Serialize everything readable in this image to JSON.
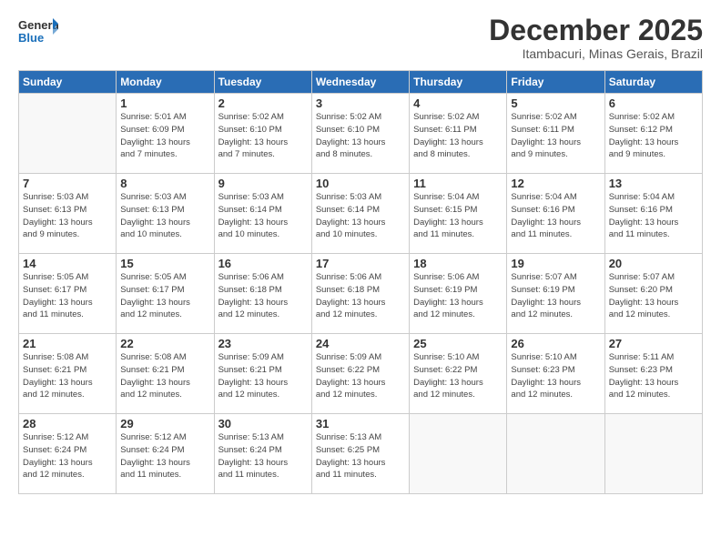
{
  "header": {
    "logo_line1": "General",
    "logo_line2": "Blue",
    "month": "December 2025",
    "location": "Itambacuri, Minas Gerais, Brazil"
  },
  "weekdays": [
    "Sunday",
    "Monday",
    "Tuesday",
    "Wednesday",
    "Thursday",
    "Friday",
    "Saturday"
  ],
  "weeks": [
    [
      {
        "day": "",
        "info": ""
      },
      {
        "day": "1",
        "info": "Sunrise: 5:01 AM\nSunset: 6:09 PM\nDaylight: 13 hours\nand 7 minutes."
      },
      {
        "day": "2",
        "info": "Sunrise: 5:02 AM\nSunset: 6:10 PM\nDaylight: 13 hours\nand 7 minutes."
      },
      {
        "day": "3",
        "info": "Sunrise: 5:02 AM\nSunset: 6:10 PM\nDaylight: 13 hours\nand 8 minutes."
      },
      {
        "day": "4",
        "info": "Sunrise: 5:02 AM\nSunset: 6:11 PM\nDaylight: 13 hours\nand 8 minutes."
      },
      {
        "day": "5",
        "info": "Sunrise: 5:02 AM\nSunset: 6:11 PM\nDaylight: 13 hours\nand 9 minutes."
      },
      {
        "day": "6",
        "info": "Sunrise: 5:02 AM\nSunset: 6:12 PM\nDaylight: 13 hours\nand 9 minutes."
      }
    ],
    [
      {
        "day": "7",
        "info": "Sunrise: 5:03 AM\nSunset: 6:13 PM\nDaylight: 13 hours\nand 9 minutes."
      },
      {
        "day": "8",
        "info": "Sunrise: 5:03 AM\nSunset: 6:13 PM\nDaylight: 13 hours\nand 10 minutes."
      },
      {
        "day": "9",
        "info": "Sunrise: 5:03 AM\nSunset: 6:14 PM\nDaylight: 13 hours\nand 10 minutes."
      },
      {
        "day": "10",
        "info": "Sunrise: 5:03 AM\nSunset: 6:14 PM\nDaylight: 13 hours\nand 10 minutes."
      },
      {
        "day": "11",
        "info": "Sunrise: 5:04 AM\nSunset: 6:15 PM\nDaylight: 13 hours\nand 11 minutes."
      },
      {
        "day": "12",
        "info": "Sunrise: 5:04 AM\nSunset: 6:16 PM\nDaylight: 13 hours\nand 11 minutes."
      },
      {
        "day": "13",
        "info": "Sunrise: 5:04 AM\nSunset: 6:16 PM\nDaylight: 13 hours\nand 11 minutes."
      }
    ],
    [
      {
        "day": "14",
        "info": "Sunrise: 5:05 AM\nSunset: 6:17 PM\nDaylight: 13 hours\nand 11 minutes."
      },
      {
        "day": "15",
        "info": "Sunrise: 5:05 AM\nSunset: 6:17 PM\nDaylight: 13 hours\nand 12 minutes."
      },
      {
        "day": "16",
        "info": "Sunrise: 5:06 AM\nSunset: 6:18 PM\nDaylight: 13 hours\nand 12 minutes."
      },
      {
        "day": "17",
        "info": "Sunrise: 5:06 AM\nSunset: 6:18 PM\nDaylight: 13 hours\nand 12 minutes."
      },
      {
        "day": "18",
        "info": "Sunrise: 5:06 AM\nSunset: 6:19 PM\nDaylight: 13 hours\nand 12 minutes."
      },
      {
        "day": "19",
        "info": "Sunrise: 5:07 AM\nSunset: 6:19 PM\nDaylight: 13 hours\nand 12 minutes."
      },
      {
        "day": "20",
        "info": "Sunrise: 5:07 AM\nSunset: 6:20 PM\nDaylight: 13 hours\nand 12 minutes."
      }
    ],
    [
      {
        "day": "21",
        "info": "Sunrise: 5:08 AM\nSunset: 6:21 PM\nDaylight: 13 hours\nand 12 minutes."
      },
      {
        "day": "22",
        "info": "Sunrise: 5:08 AM\nSunset: 6:21 PM\nDaylight: 13 hours\nand 12 minutes."
      },
      {
        "day": "23",
        "info": "Sunrise: 5:09 AM\nSunset: 6:21 PM\nDaylight: 13 hours\nand 12 minutes."
      },
      {
        "day": "24",
        "info": "Sunrise: 5:09 AM\nSunset: 6:22 PM\nDaylight: 13 hours\nand 12 minutes."
      },
      {
        "day": "25",
        "info": "Sunrise: 5:10 AM\nSunset: 6:22 PM\nDaylight: 13 hours\nand 12 minutes."
      },
      {
        "day": "26",
        "info": "Sunrise: 5:10 AM\nSunset: 6:23 PM\nDaylight: 13 hours\nand 12 minutes."
      },
      {
        "day": "27",
        "info": "Sunrise: 5:11 AM\nSunset: 6:23 PM\nDaylight: 13 hours\nand 12 minutes."
      }
    ],
    [
      {
        "day": "28",
        "info": "Sunrise: 5:12 AM\nSunset: 6:24 PM\nDaylight: 13 hours\nand 12 minutes."
      },
      {
        "day": "29",
        "info": "Sunrise: 5:12 AM\nSunset: 6:24 PM\nDaylight: 13 hours\nand 11 minutes."
      },
      {
        "day": "30",
        "info": "Sunrise: 5:13 AM\nSunset: 6:24 PM\nDaylight: 13 hours\nand 11 minutes."
      },
      {
        "day": "31",
        "info": "Sunrise: 5:13 AM\nSunset: 6:25 PM\nDaylight: 13 hours\nand 11 minutes."
      },
      {
        "day": "",
        "info": ""
      },
      {
        "day": "",
        "info": ""
      },
      {
        "day": "",
        "info": ""
      }
    ]
  ]
}
